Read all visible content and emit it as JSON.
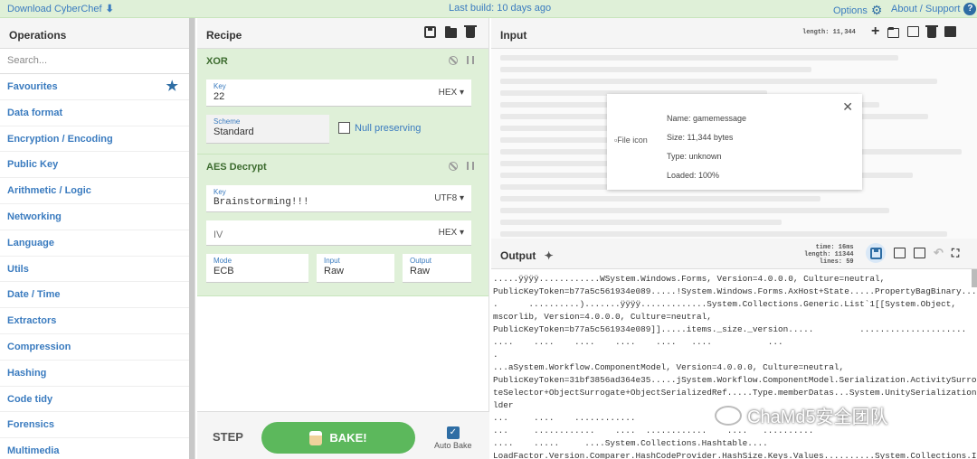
{
  "topbar": {
    "download": "Download CyberChef",
    "build": "Last build: 10 days ago",
    "options": "Options",
    "about": "About / Support"
  },
  "operations": {
    "title": "Operations",
    "search_placeholder": "Search...",
    "categories": [
      "Favourites",
      "Data format",
      "Encryption / Encoding",
      "Public Key",
      "Arithmetic / Logic",
      "Networking",
      "Language",
      "Utils",
      "Date / Time",
      "Extractors",
      "Compression",
      "Hashing",
      "Code tidy",
      "Forensics",
      "Multimedia"
    ]
  },
  "recipe": {
    "title": "Recipe",
    "xor": {
      "name": "XOR",
      "key_label": "Key",
      "key_value": "22",
      "key_format": "HEX",
      "scheme_label": "Scheme",
      "scheme_value": "Standard",
      "null_preserving": "Null preserving"
    },
    "aes": {
      "name": "AES Decrypt",
      "key_label": "Key",
      "key_value": "Brainstorming!!!",
      "key_format": "UTF8",
      "iv_label": "IV",
      "iv_format": "HEX",
      "mode_label": "Mode",
      "mode_value": "ECB",
      "input_label": "Input",
      "input_value": "Raw",
      "output_label": "Output",
      "output_value": "Raw"
    },
    "step": "STEP",
    "bake": "BAKE!",
    "auto_bake": "Auto Bake"
  },
  "input": {
    "title": "Input",
    "length_stat": "length: 11,344",
    "file": {
      "icon_alt": "File icon",
      "name": "Name: gamemessage",
      "size": "Size: 11,344 bytes",
      "type": "Type: unknown",
      "loaded": "Loaded: 100%"
    }
  },
  "output": {
    "title": "Output",
    "stat_time": "time:  16ms",
    "stat_length": "length: 11344",
    "stat_lines": "lines:    59",
    "lines": [
      ".....ÿÿÿÿ............WSystem.Windows.Forms, Version=4.0.0.0, Culture=neutral,",
      "PublicKeyToken=b77a5c561934e089.....!System.Windows.Forms.AxHost+State.....PropertyBagBinary.....",
      ".      ..........).......ÿÿÿÿ.............System.Collections.Generic.List`1[[System.Object,",
      "mscorlib, Version=4.0.0.0, Culture=neutral,",
      "PublicKeyToken=b77a5c561934e089]].....items._size._version.....         .....................",
      "....    ....    ....    ....    ....   ....           ...",
      ".",
      "...aSystem.Workflow.ComponentModel, Version=4.0.0.0, Culture=neutral,",
      "PublicKeyToken=31bf3856ad364e35.....jSystem.Workflow.ComponentModel.Serialization.ActivitySurroga",
      "teSelector+ObjectSurrogate+ObjectSerializedRef.....Type.memberDatas...System.UnitySerializationHo",
      "lder",
      "...     ....    ............",
      "...     ............    ....  ............    ....   ..........",
      "....    .....     ....System.Collections.Hashtable....",
      "LoadFactor.Version.Comparer.HashCodeProvider.HashSize.Keys.Values..........System.Collections.ICo"
    ]
  },
  "watermark": "ChaMd5安全团队"
}
